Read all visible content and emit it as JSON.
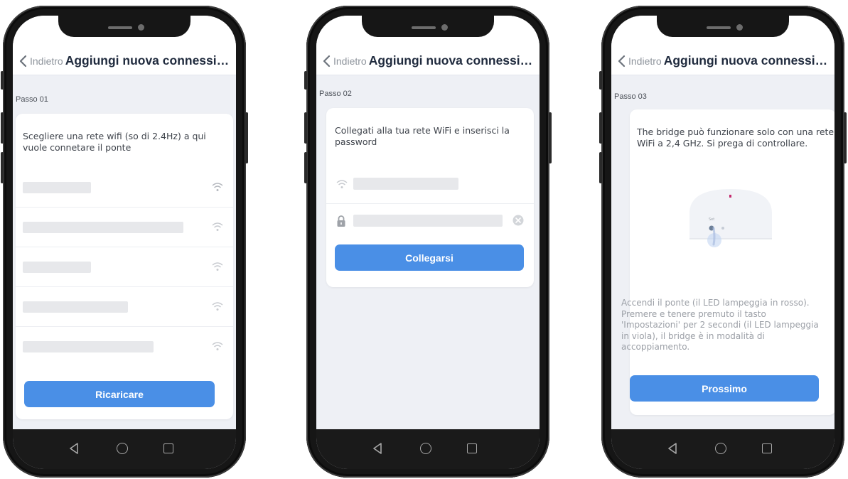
{
  "colors": {
    "accent": "#4a8fe6",
    "screen_bg": "#eef0f5",
    "title": "#1f2a3d",
    "muted_text": "#8e949c",
    "led": "#c42a6e"
  },
  "common": {
    "back_label": "Indietro",
    "nav_title": "Aggiungi nuova connessione"
  },
  "screens": [
    {
      "step_label": "Passo 01",
      "instruction": "Scegliere una rete wifi (so di 2.4Hz) a qui vuole connetare il ponte",
      "wifi_networks": [
        {
          "signal_icon": "wifi-icon"
        },
        {
          "signal_icon": "wifi-icon"
        },
        {
          "signal_icon": "wifi-icon"
        },
        {
          "signal_icon": "wifi-icon"
        },
        {
          "signal_icon": "wifi-icon"
        }
      ],
      "button_label": "Ricaricare"
    },
    {
      "step_label": "Passo 02",
      "instruction": "Collegati alla tua rete WiFi e inserisci la password",
      "ssid_icon": "wifi-icon",
      "password_icon": "lock-icon",
      "clear_icon": "clear-icon",
      "button_label": "Collegarsi"
    },
    {
      "step_label": "Passo 03",
      "instruction": "The bridge può funzionare solo con una rete WiFi a 2,4 GHz. Si prega di controllare.",
      "device_button_label": "Set",
      "pairing_instructions": "Accendi il ponte (il LED lampeggia in rosso). Premere e tenere premuto il tasto 'Impostazioni' per 2 secondi (il LED lampeggia in viola), il bridge è in modalità di accoppiamento.",
      "button_label": "Prossimo"
    }
  ],
  "system_nav": {
    "back_icon": "triangle-back-icon",
    "home_icon": "circle-home-icon",
    "recent_icon": "square-recent-icon"
  }
}
